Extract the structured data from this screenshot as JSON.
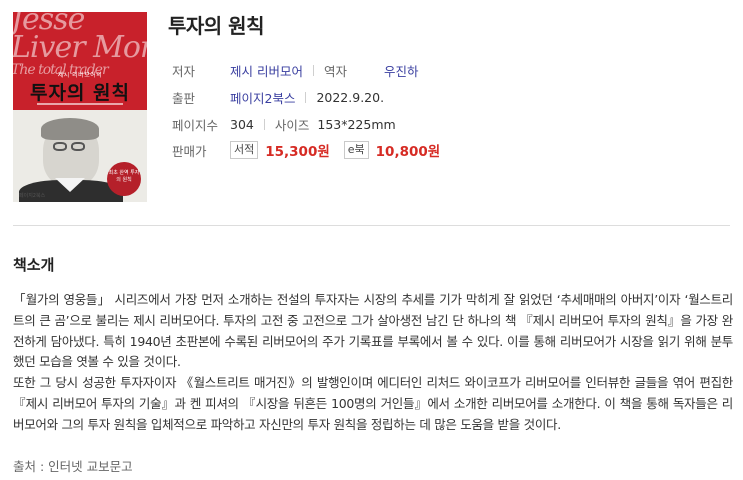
{
  "book": {
    "title": "투자의 원칙",
    "cover": {
      "script_lines": [
        "Jesse",
        "Liver More",
        "The total trader"
      ],
      "subtitle": "제시 리버모어의",
      "title": "투자의 원칙",
      "badge": "최초 완역 투자의 원칙",
      "publisher": "페이지2북스"
    },
    "meta": {
      "author_label": "저자",
      "author": "제시 리버모어",
      "translator_label": "역자",
      "translator": "우진하",
      "publisher_label": "출판",
      "publisher": "페이지2북스",
      "pub_date": "2022.9.20.",
      "pages_label": "페이지수",
      "pages": "304",
      "size_label": "사이즈",
      "size": "153*225mm",
      "price_label": "판매가",
      "paper_tag": "서적",
      "paper_price": "15,300원",
      "ebook_tag": "e북",
      "ebook_price": "10,800원"
    }
  },
  "intro": {
    "heading": "책소개",
    "paragraphs": [
      "「월가의 영웅들」 시리즈에서 가장 먼저 소개하는 전설의 투자자는 시장의 추세를 기가 막히게 잘 읽었던 ‘추세매매의 아버지’이자 ‘월스트리트의 큰 곰’으로 불리는 제시 리버모어다. 투자의 고전 중 고전으로 그가 살아생전 남긴 단 하나의 책 『제시 리버모어 투자의 원칙』을 가장 완전하게 담아냈다. 특히 1940년 초판본에 수록된 리버모어의 주가 기록표를 부록에서 볼 수 있다. 이를 통해 리버모어가 시장을 읽기 위해 분투했던 모습을 엿볼 수 있을 것이다.",
      "또한 그 당시 성공한 투자자이자 《월스트리트 매거진》의 발행인이며 에디터인 리처드 와이코프가 리버모어를 인터뷰한 글들을 엮어 편집한 『제시 리버모어 투자의 기술』과 켄 피셔의 『시장을 뒤흔든 100명의 거인들』에서 소개한 리버모어를 소개한다. 이 책을 통해 독자들은 리버모어와 그의 투자 원칙을 입체적으로 파악하고 자신만의 투자 원칙을 정립하는 데 많은 도움을 받을 것이다."
    ],
    "source": "출처 : 인터넷 교보문고"
  },
  "colors": {
    "link": "#3a3fa0",
    "price": "#d62b24",
    "cover_red": "#c8212b"
  }
}
